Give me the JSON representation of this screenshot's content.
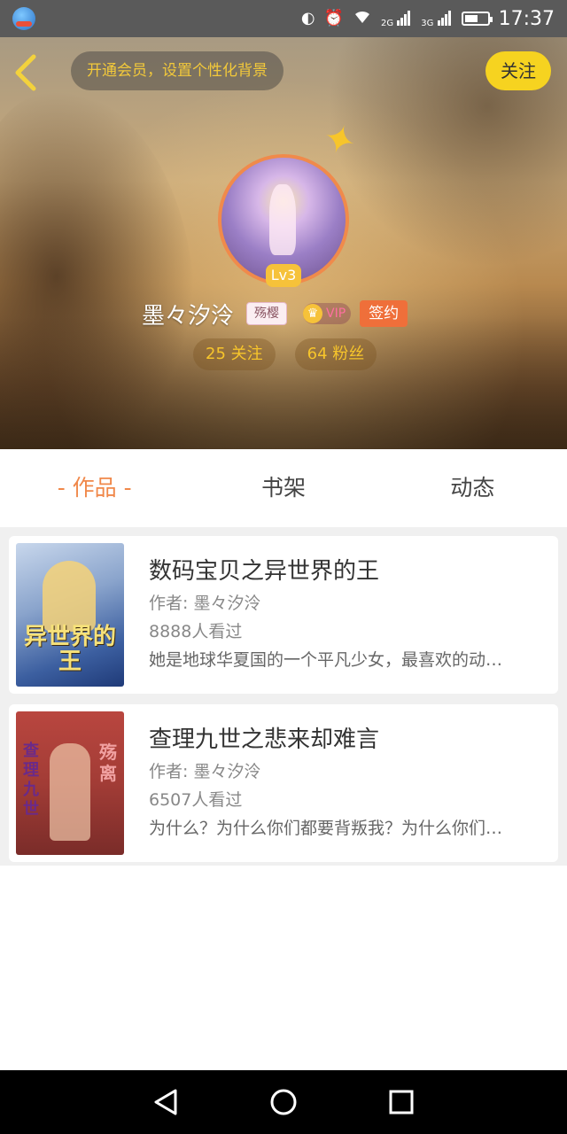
{
  "status_bar": {
    "time": "17:37",
    "net1": "2G",
    "net2": "3G",
    "icons": [
      "app-logo-icon",
      "hd-icon",
      "alarm-icon",
      "wifi-icon",
      "signal-icon",
      "signal-icon",
      "battery-icon"
    ]
  },
  "header": {
    "back_icon": "chevron-left-icon",
    "bg_hint": "开通会员，设置个性化背景",
    "follow_label": "关注"
  },
  "profile": {
    "level": "Lv3",
    "username": "墨々汐泠",
    "title_tag": "殇樱",
    "vip_label": "VIP",
    "sign_label": "签约",
    "following": "25 关注",
    "followers": "64 粉丝"
  },
  "tabs": [
    {
      "label": "- 作品 -",
      "active": true
    },
    {
      "label": "书架",
      "active": false
    },
    {
      "label": "动态",
      "active": false
    }
  ],
  "books": [
    {
      "title": "数码宝贝之异世界的王",
      "author": "作者: 墨々汐泠",
      "views": "8888人看过",
      "desc": "她是地球华夏国的一个平凡少女，最喜欢的动…",
      "cover_text": "异世界的王"
    },
    {
      "title": "查理九世之悲来却难言",
      "author": "作者: 墨々汐泠",
      "views": "6507人看过",
      "desc": "为什么？为什么你们都要背叛我？为什么你们…",
      "cover_text_left": "查理九世",
      "cover_text_right": "殇离"
    }
  ],
  "colors": {
    "accent_orange": "#f0884a",
    "follow_yellow": "#f6d320",
    "sign_orange": "#ef6f3a"
  }
}
